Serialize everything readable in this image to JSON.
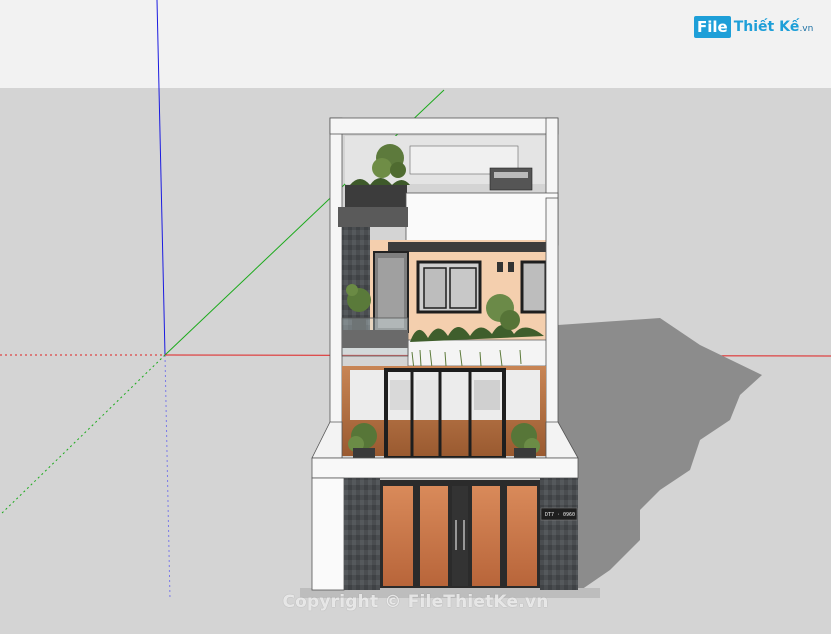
{
  "scene": {
    "sky_color": "#f1f1f1",
    "ground_color": "#d5d5d5",
    "axis_colors": {
      "red": "#e02020",
      "green": "#20b020",
      "blue": "#2020e0"
    }
  },
  "logo": {
    "badge": "File",
    "name": "Thiết Kế",
    "tld": ".vn",
    "color": "#1e9fd8"
  },
  "watermark": "Copyright © FileThietKe.vn",
  "house_number_plaque": "DT7 · 0960"
}
